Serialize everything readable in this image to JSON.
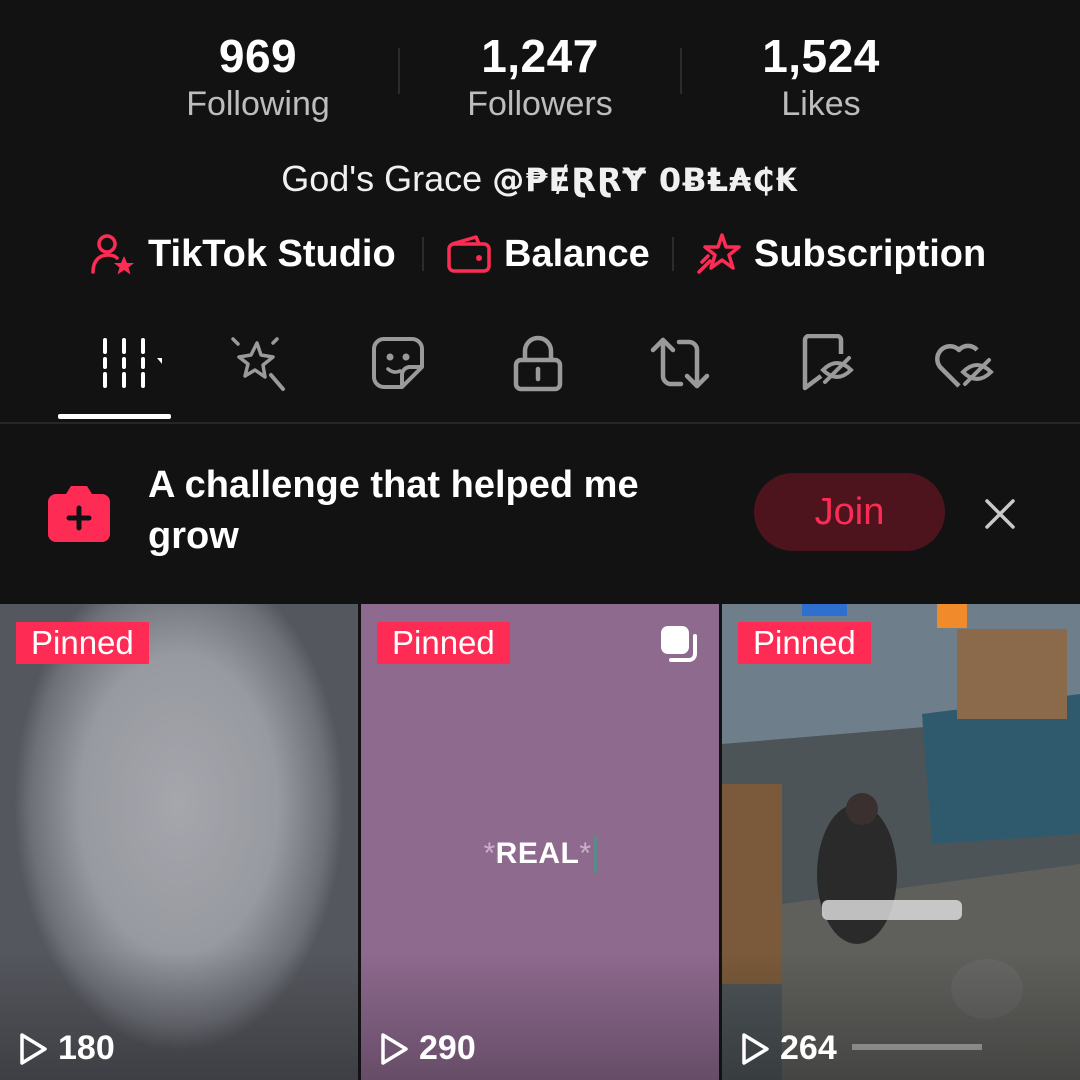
{
  "stats": [
    {
      "value": "969",
      "label": "Following"
    },
    {
      "value": "1,247",
      "label": "Followers"
    },
    {
      "value": "1,524",
      "label": "Likes"
    }
  ],
  "bio": {
    "text": "God's Grace",
    "handle": "@₱ɆⱤⱤɎ 0ɃⱠ₳₵₭"
  },
  "links": [
    {
      "label": "TikTok Studio",
      "icon": "person-star-icon"
    },
    {
      "label": "Balance",
      "icon": "wallet-icon"
    },
    {
      "label": "Subscription",
      "icon": "star-badge-icon"
    }
  ],
  "tabs": [
    {
      "icon": "videos-grid-icon",
      "active": true
    },
    {
      "icon": "magic-wand-icon"
    },
    {
      "icon": "sticker-icon"
    },
    {
      "icon": "lock-icon"
    },
    {
      "icon": "repost-icon"
    },
    {
      "icon": "bookmark-hidden-icon"
    },
    {
      "icon": "heart-hidden-icon"
    }
  ],
  "banner": {
    "text": "A challenge that helped me grow",
    "join_label": "Join"
  },
  "videos": [
    {
      "badge": "Pinned",
      "views": "180"
    },
    {
      "badge": "Pinned",
      "views": "290",
      "caption": "REAL",
      "multi": true
    },
    {
      "badge": "Pinned",
      "views": "264"
    }
  ],
  "colors": {
    "accent": "#fe2c55",
    "background": "#121212",
    "join_bg": "#4d141e"
  }
}
